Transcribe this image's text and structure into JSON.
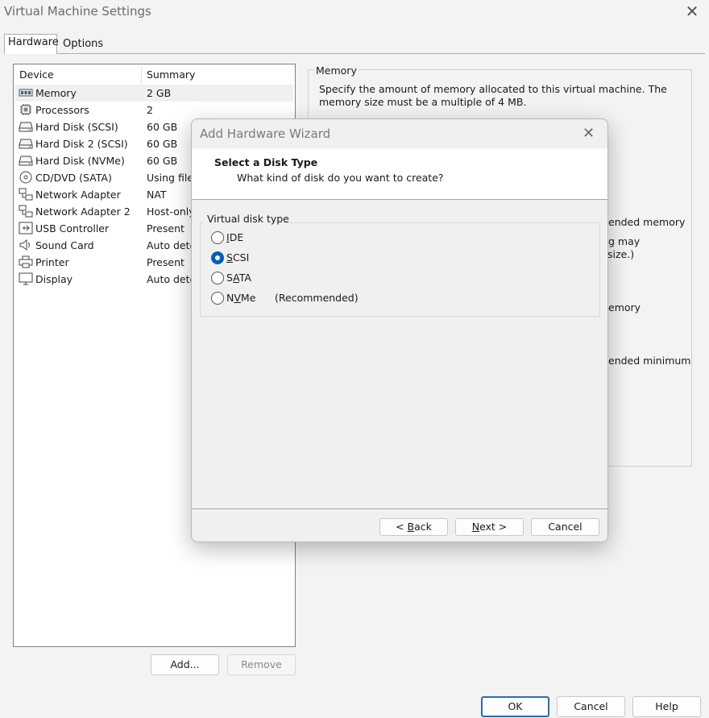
{
  "window": {
    "title": "Virtual Machine Settings",
    "close_glyph": "✕"
  },
  "tabs": [
    {
      "label": "Hardware",
      "active": true
    },
    {
      "label": "Options",
      "active": false
    }
  ],
  "device_list": {
    "columns": [
      "Device",
      "Summary"
    ],
    "rows": [
      {
        "device": "Memory",
        "summary": "2 GB",
        "icon": "memory-icon",
        "selected": true
      },
      {
        "device": "Processors",
        "summary": "2",
        "icon": "processor-icon"
      },
      {
        "device": "Hard Disk (SCSI)",
        "summary": "60 GB",
        "icon": "hard-disk-icon"
      },
      {
        "device": "Hard Disk 2 (SCSI)",
        "summary": "60 GB",
        "icon": "hard-disk-icon"
      },
      {
        "device": "Hard Disk (NVMe)",
        "summary": "60 GB",
        "icon": "hard-disk-icon"
      },
      {
        "device": "CD/DVD (SATA)",
        "summary": "Using file",
        "icon": "cd-dvd-icon"
      },
      {
        "device": "Network Adapter",
        "summary": "NAT",
        "icon": "network-adapter-icon"
      },
      {
        "device": "Network Adapter 2",
        "summary": "Host-only",
        "icon": "network-adapter-icon"
      },
      {
        "device": "USB Controller",
        "summary": "Present",
        "icon": "usb-icon"
      },
      {
        "device": "Sound Card",
        "summary": "Auto dete",
        "icon": "speaker-icon"
      },
      {
        "device": "Printer",
        "summary": "Present",
        "icon": "printer-icon"
      },
      {
        "device": "Display",
        "summary": "Auto dete",
        "icon": "monitor-icon"
      }
    ]
  },
  "list_buttons": {
    "add": "Add...",
    "remove": "Remove"
  },
  "memory_panel": {
    "legend": "Memory",
    "description": "Specify the amount of memory allocated to this virtual machine. The memory size must be a multiple of 4 MB.",
    "partial_texts": [
      "ended memory",
      "g may",
      "size.)",
      "emory",
      "ended minimum"
    ]
  },
  "footer_buttons": {
    "ok": "OK",
    "cancel": "Cancel",
    "help": "Help"
  },
  "wizard": {
    "title": "Add Hardware Wizard",
    "close_glyph": "✕",
    "heading": "Select a Disk Type",
    "subheading": "What kind of disk do you want to create?",
    "group_label": "Virtual disk type",
    "options": [
      {
        "pre": "",
        "accel": "I",
        "post": "DE",
        "note": "",
        "checked": false
      },
      {
        "pre": "",
        "accel": "S",
        "post": "CSI",
        "note": "",
        "checked": true
      },
      {
        "pre": "S",
        "accel": "A",
        "post": "TA",
        "note": "",
        "checked": false
      },
      {
        "pre": "N",
        "accel": "V",
        "post": "Me",
        "note": "(Recommended)",
        "checked": false
      }
    ],
    "buttons": {
      "back_pre": "< ",
      "back_accel": "B",
      "back_post": "ack",
      "next_accel": "N",
      "next_post": "ext >",
      "cancel": "Cancel"
    }
  }
}
